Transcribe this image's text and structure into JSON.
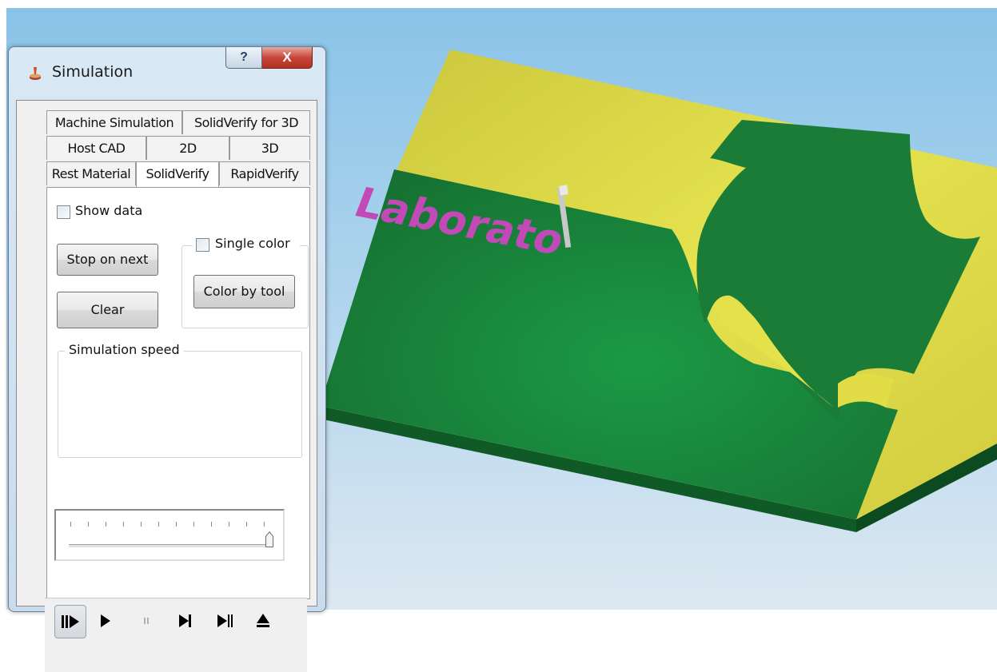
{
  "window": {
    "title": "Simulation",
    "help_glyph": "?",
    "close_glyph": "X"
  },
  "tabs": {
    "row1": [
      "Machine Simulation",
      "SolidVerify for 3D"
    ],
    "row2": [
      "Host CAD",
      "2D",
      "3D"
    ],
    "row3": [
      "Rest Material",
      "SolidVerify",
      "RapidVerify"
    ],
    "active": "SolidVerify"
  },
  "panel": {
    "show_data_label": "Show data",
    "show_data_checked": false,
    "stop_button": "Stop on next",
    "clear_button": "Clear",
    "single_color_label": "Single color",
    "single_color_checked": false,
    "color_by_tool_button": "Color by tool",
    "speed_group_label": "Simulation speed",
    "speed_level": 1.0
  },
  "playback": {
    "buttons": [
      "step-play-icon",
      "play-icon",
      "pause-icon",
      "step-forward-icon",
      "skip-to-end-icon",
      "eject-icon"
    ]
  },
  "scene": {
    "engraved_text": "Laborato",
    "colors": {
      "stock_yellow": "#d9d94a",
      "machined_green": "#1c7f38",
      "engrave_magenta": "#c24ab8",
      "sky_top": "#89c3e8"
    }
  }
}
